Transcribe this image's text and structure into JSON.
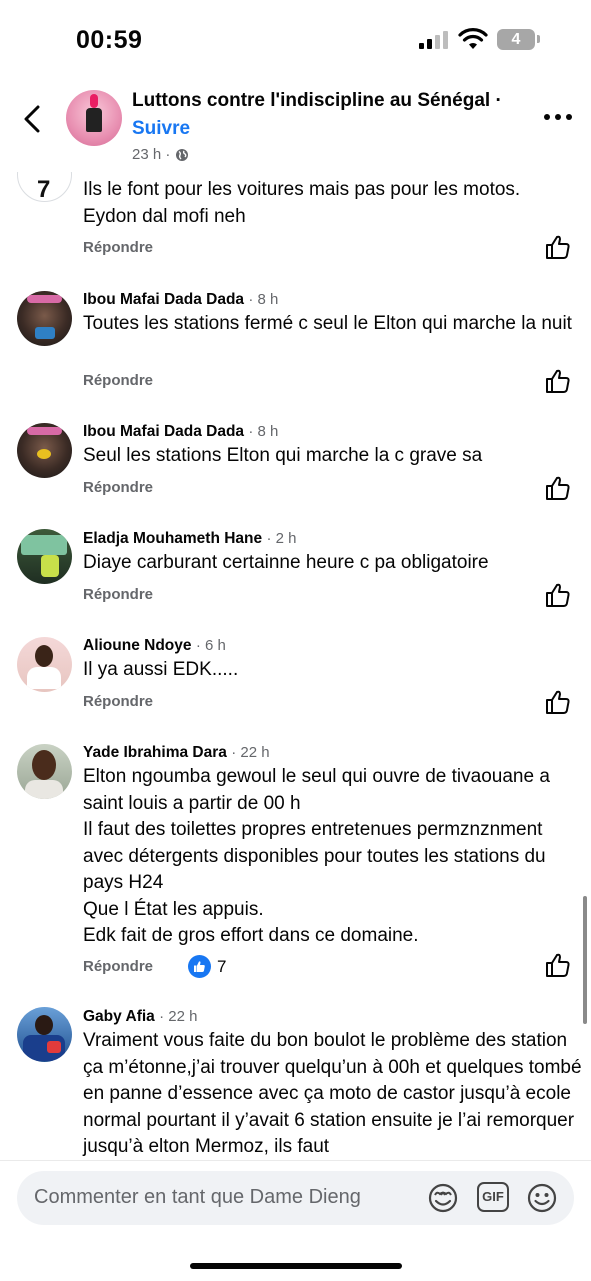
{
  "status_bar": {
    "time": "00:59",
    "battery_level": "4"
  },
  "header": {
    "group_name": "Luttons contre l'indiscipline au Sénégal ·",
    "follow_label": "Suivre",
    "post_time": "23 h ·"
  },
  "comments": [
    {
      "author": "",
      "time": "",
      "text": "Ils le font pour les voitures mais pas pour les motos.\nEydon dal mofi neh",
      "reply_label": "Répondre"
    },
    {
      "author": "Ibou Mafai Dada Dada",
      "time": "· 8 h",
      "text": "Toutes les stations fermé c seul le Elton qui marche la nuit",
      "reply_label": "Répondre"
    },
    {
      "author": "Ibou Mafai Dada Dada",
      "time": "· 8 h",
      "text": "Seul les stations Elton qui marche la c grave sa",
      "reply_label": "Répondre"
    },
    {
      "author": "Eladja Mouhameth Hane",
      "time": "· 2 h",
      "text": "Diaye carburant certainne heure c pa obligatoire",
      "reply_label": "Répondre"
    },
    {
      "author": "Alioune Ndoye",
      "time": "· 6 h",
      "text": "Il ya aussi EDK.....",
      "reply_label": "Répondre"
    },
    {
      "author": "Yade Ibrahima Dara",
      "time": "· 22 h",
      "text": "Elton ngoumba gewoul le seul qui ouvre de tivaouane a saint louis a partir de 00 h\nIl faut des toilettes propres entretenues permznznment avec détergents disponibles pour toutes les stations du pays H24\nQue l État les appuis.\nEdk fait de gros effort dans ce domaine.",
      "reply_label": "Répondre",
      "reaction_count": "7"
    },
    {
      "author": "Gaby Afia",
      "time": "· 22 h",
      "text": "Vraiment vous faite du bon boulot le problème des station ça m’étonne,j’ai trouver quelqu’un à 00h et quelques tombé en panne d’essence avec ça moto de castor jusqu’à ecole normal pourtant il y’avait 6 station ensuite je l’ai remorquer jusqu’à elton Mermoz, ils faut",
      "reply_label": ""
    }
  ],
  "composer": {
    "placeholder": "Commenter en tant que Dame Dieng",
    "gif_label": "GIF"
  },
  "icons": [
    "back-icon",
    "more-icon",
    "globe-icon",
    "like-icon",
    "sticker-icon",
    "gif-icon",
    "emoji-icon"
  ],
  "colors": {
    "accent": "#1877f2",
    "secondary_text": "#65676b",
    "input_bg": "#f0f2f5"
  }
}
